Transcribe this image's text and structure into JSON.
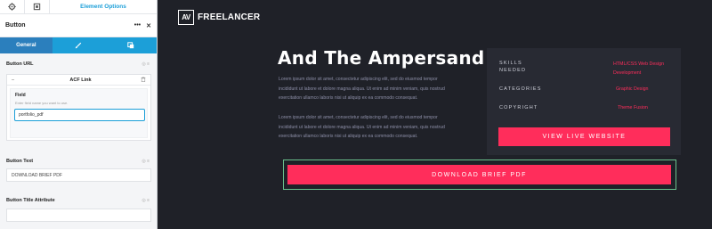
{
  "panel": {
    "top": {
      "title": "Element Options",
      "icons": [
        "gear-icon",
        "layers-icon"
      ]
    },
    "header": {
      "title": "Button",
      "more": "•••",
      "close": "✕"
    },
    "tabs": [
      {
        "label": "General",
        "active": true
      },
      {
        "label": "",
        "icon": "brush-icon"
      },
      {
        "label": "",
        "icon": "layers-icon"
      }
    ],
    "button_url": {
      "label": "Button URL",
      "acf": {
        "title": "ACF Link",
        "field_label": "Field",
        "hint": "Enter field name you want to use.",
        "value": "portfolio_pdf"
      }
    },
    "button_text": {
      "label": "Button Text",
      "value": "DOWNLOAD BRIEF PDF"
    },
    "button_title_attr": {
      "label": "Button Title Attribute",
      "value": ""
    }
  },
  "preview": {
    "logo": {
      "badge": "AV",
      "name": "FREELANCER"
    },
    "heading": "And The Ampersand",
    "paragraphs": [
      [
        "Lorem ipsum dolor sit amet, consectetur adipiscing elit, sed do eiusmod tempor",
        "incididunt ut labore et dolore magna aliqua. Ut enim ad minim veniam, quis nostrud",
        "exercitation ullamco laboris nisi ut aliquip ex ea commodo consequat."
      ],
      [
        "Lorem ipsum dolor sit amet, consectetur adipiscing elit, sed do eiusmod tempor",
        "incididunt ut labore et dolore magna aliqua. Ut enim ad minim veniam, quis nostrud",
        "exercitation ullamco laboris nisi ut aliquip ex ea commodo consequat."
      ]
    ],
    "details": {
      "skills_label_1": "SKILLS",
      "skills_label_2": "NEEDED",
      "skills_value_1": "HTML/CSS Web Design",
      "skills_value_2": "Development",
      "categories_label": "CATEGORIES",
      "categories_value": "Graphic Design",
      "copyright_label": "COPYRIGHT",
      "copyright_value": "Theme Fusion"
    },
    "live_button": "VIEW LIVE WEBSITE",
    "download_button": "DOWNLOAD BRIEF PDF"
  },
  "colors": {
    "accent": "#ff2d5b",
    "panel_blue": "#1c9fd8",
    "background": "#1f2128",
    "selection_outline": "#6ac18d"
  }
}
